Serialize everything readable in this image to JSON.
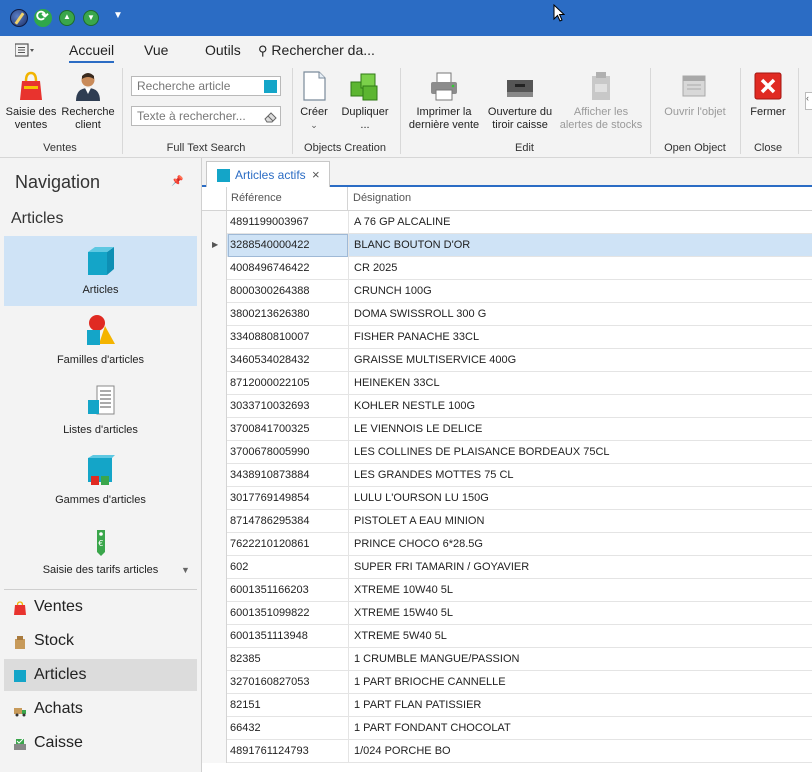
{
  "quick_access": {
    "icons": [
      "app-icon",
      "refresh-icon",
      "arrow-up-icon",
      "arrow-down-icon",
      "chevron-down-icon"
    ]
  },
  "ribbon_tabs": {
    "menu_icon": "menu-icon",
    "items": [
      "Accueil",
      "Vue",
      "Outils"
    ],
    "active": "Accueil",
    "search_label": "Rechercher da..."
  },
  "ribbon": {
    "ventes_group": {
      "label": "Ventes",
      "saisie_ventes": "Saisie des ventes",
      "recherche_client": "Recherche client"
    },
    "fts_group": {
      "label": "Full Text Search",
      "recherche_article_placeholder": "Recherche article",
      "texte_placeholder": "Texte à rechercher..."
    },
    "objects_group": {
      "label": "Objects Creation",
      "creer": "Créer",
      "dupliquer": "Dupliquer",
      "dupliquer_more": "..."
    },
    "edit_group": {
      "label": "Edit",
      "imprimer": "Imprimer la dernière vente",
      "ouverture": "Ouverture du tiroir caisse",
      "alertes": "Afficher les alertes de stocks"
    },
    "open_group": {
      "label": "Open Object",
      "ouvrir": "Ouvrir l'objet"
    },
    "close_group": {
      "label": "Close",
      "fermer": "Fermer"
    }
  },
  "navigation": {
    "title": "Navigation",
    "section": "Articles",
    "big_items": [
      "Articles",
      "Familles d'articles",
      "Listes d'articles",
      "Gammes d'articles",
      "Saisie des tarifs articles"
    ],
    "modules": [
      "Ventes",
      "Stock",
      "Articles",
      "Achats",
      "Caisse"
    ],
    "active_module": "Articles"
  },
  "document": {
    "tab_label": "Articles actifs",
    "columns": [
      "Référence",
      "Désignation"
    ],
    "selected_index": 1,
    "rows": [
      [
        "4891199003967",
        "A 76 GP ALCALINE"
      ],
      [
        "3288540000422",
        "BLANC BOUTON D'OR"
      ],
      [
        "4008496746422",
        "CR 2025"
      ],
      [
        "8000300264388",
        "CRUNCH  100G"
      ],
      [
        "3800213626380",
        "DOMA SWISSROLL 300 G"
      ],
      [
        "3340880810007",
        "FISHER PANACHE 33CL"
      ],
      [
        "3460534028432",
        "GRAISSE MULTISERVICE 400G"
      ],
      [
        "8712000022105",
        "HEINEKEN 33CL"
      ],
      [
        "3033710032693",
        "KOHLER NESTLE 100G"
      ],
      [
        "3700841700325",
        "LE VIENNOIS LE DELICE"
      ],
      [
        "3700678005990",
        "LES COLLINES DE PLAISANCE BORDEAUX 75CL"
      ],
      [
        "3438910873884",
        "LES GRANDES MOTTES 75 CL"
      ],
      [
        "3017769149854",
        "LULU L'OURSON LU 150G"
      ],
      [
        "8714786295384",
        "PISTOLET A EAU MINION"
      ],
      [
        "7622210120861",
        "PRINCE CHOCO 6*28.5G"
      ],
      [
        "602",
        "SUPER FRI TAMARIN / GOYAVIER"
      ],
      [
        "6001351166203",
        "XTREME 10W40 5L"
      ],
      [
        "6001351099822",
        "XTREME 15W40 5L"
      ],
      [
        "6001351113948",
        "XTREME 5W40 5L"
      ],
      [
        "82385",
        "1 CRUMBLE MANGUE/PASSION"
      ],
      [
        "3270160827053",
        "1 PART BRIOCHE CANNELLE"
      ],
      [
        "82151",
        "1 PART FLAN PATISSIER"
      ],
      [
        "66432",
        "1 PART FONDANT CHOCOLAT"
      ],
      [
        "4891761124793",
        "1/024 PORCHE BO"
      ]
    ]
  },
  "colors": {
    "titlebar": "#2b6cc4",
    "selection": "#cfe3f6",
    "accent": "#14a5c8"
  }
}
